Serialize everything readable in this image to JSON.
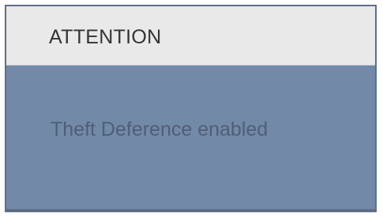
{
  "dialog": {
    "title": "ATTENTION",
    "message": "Theft Deference enabled"
  },
  "colors": {
    "header_background": "#e9e9e9",
    "body_background": "#7389a8",
    "frame_border": "#5f6f86",
    "title_text": "#333333",
    "message_text": "#4f5f76"
  }
}
